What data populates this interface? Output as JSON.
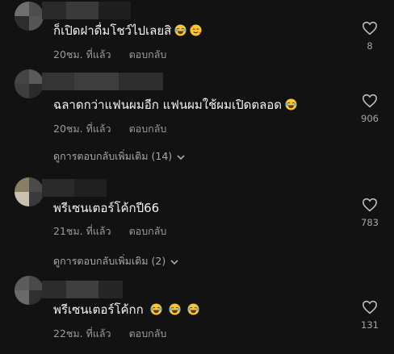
{
  "comments": [
    {
      "text": "ก็เปิดฝาดื่มโชว์ไปเลยสิ",
      "emojis": [
        "😂",
        "🥰"
      ],
      "time": "20ชม. ที่แล้ว",
      "reply_label": "ตอบกลับ",
      "likes": "8"
    },
    {
      "text": "ฉลาดกว่าแฟนผมอีก แฟนผมใช้ผมเปิดตลอด",
      "emojis": [
        "😂"
      ],
      "time": "20ชม. ที่แล้ว",
      "reply_label": "ตอบกลับ",
      "likes": "906",
      "more_replies": "ดูการตอบกลับเพิ่มเติม (14)"
    },
    {
      "text": "พรีเซนเตอร์โค้กปี66",
      "emojis": [],
      "time": "21ชม. ที่แล้ว",
      "reply_label": "ตอบกลับ",
      "likes": "783",
      "more_replies": "ดูการตอบกลับเพิ่มเติม (2)"
    },
    {
      "text": "พรีเซนเตอร์โค้กก",
      "emojis": [
        "😂",
        "😂",
        "😂"
      ],
      "time": "22ชม. ที่แล้ว",
      "reply_label": "ตอบกลับ",
      "likes": "131"
    }
  ],
  "icons": {
    "like": "heart-outline-icon",
    "expand": "chevron-down-icon",
    "laugh": "face-with-tears-of-joy-icon",
    "love": "smiling-face-with-hearts-icon"
  }
}
